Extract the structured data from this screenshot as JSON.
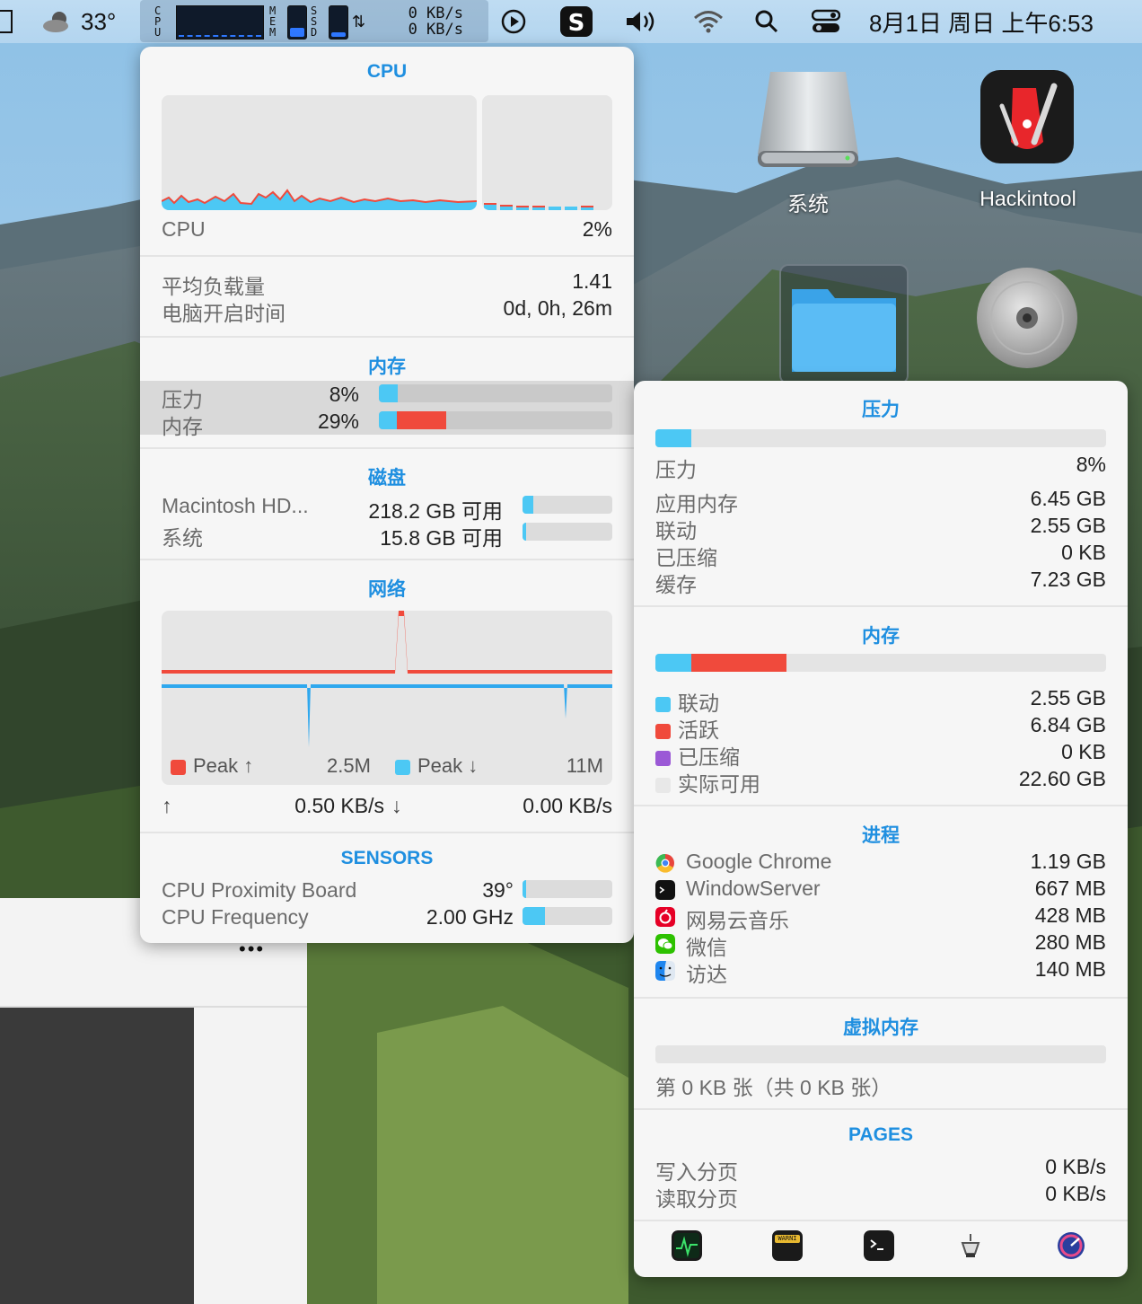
{
  "menubar": {
    "weather_temp": "33°",
    "cpu_letters": [
      "C",
      "P",
      "U"
    ],
    "mem_letters": [
      "M",
      "E",
      "M"
    ],
    "ssd_letters": [
      "S",
      "S",
      "D"
    ],
    "net_up": "0 KB/s",
    "net_down": "0 KB/s",
    "datetime": "8月1日 周日 上午6:53"
  },
  "desktop": {
    "icons": [
      {
        "label": "系统",
        "icon": "harddisk-icon"
      },
      {
        "label": "Hackintool",
        "icon": "hackintool-icon"
      },
      {
        "label": "",
        "icon": "folder-icon"
      },
      {
        "label": "",
        "icon": "disk-utility-icon"
      }
    ],
    "more_dots": "•••"
  },
  "left_panel": {
    "cpu": {
      "title": "CPU",
      "label": "CPU",
      "value": "2%",
      "load_label": "平均负载量",
      "load_value": "1.41",
      "uptime_label": "电脑开启时间",
      "uptime_value": "0d, 0h, 26m"
    },
    "memory": {
      "title": "内存",
      "pressure_label": "压力",
      "pressure_value": "8%",
      "pressure_fraction": 0.08,
      "memory_label": "内存",
      "memory_value": "29%",
      "memory_fraction": 0.29
    },
    "disk": {
      "title": "磁盘",
      "disks": [
        {
          "name": "Macintosh HD...",
          "free": "218.2 GB 可用",
          "used_fraction": 0.12
        },
        {
          "name": "系统",
          "free": "15.8 GB 可用",
          "used_fraction": 0.02
        }
      ]
    },
    "network": {
      "title": "网络",
      "peak_up_label": "Peak ↑",
      "peak_up_value": "2.5M",
      "peak_down_label": "Peak ↓",
      "peak_down_value": "11M",
      "up_arrow": "↑",
      "up_speed": "0.50 KB/s",
      "down_arrow": "↓",
      "down_speed": "0.00 KB/s"
    },
    "sensors": {
      "title": "SENSORS",
      "items": [
        {
          "name": "CPU Proximity Board",
          "value": "39°",
          "fraction": 0.02
        },
        {
          "name": "CPU Frequency",
          "value": "2.00 GHz",
          "fraction": 0.25
        }
      ]
    }
  },
  "right_panel": {
    "pressure": {
      "title": "压力",
      "fraction": 0.08,
      "rows": [
        {
          "label": "压力",
          "value": "8%"
        },
        {
          "label": "应用内存",
          "value": "6.45 GB"
        },
        {
          "label": "联动",
          "value": "2.55 GB"
        },
        {
          "label": "已压缩",
          "value": "0 KB"
        },
        {
          "label": "缓存",
          "value": "7.23 GB"
        }
      ]
    },
    "memory": {
      "title": "内存",
      "wired_fraction": 0.08,
      "active_fraction": 0.21,
      "legend": [
        {
          "label": "联动",
          "value": "2.55 GB",
          "color": "#4cc8f4"
        },
        {
          "label": "活跃",
          "value": "6.84 GB",
          "color": "#f04a3c"
        },
        {
          "label": "已压缩",
          "value": "0 KB",
          "color": "#9b59d6"
        },
        {
          "label": "实际可用",
          "value": "22.60 GB",
          "color": "#e8e8e8"
        }
      ]
    },
    "processes": {
      "title": "进程",
      "items": [
        {
          "name": "Google Chrome",
          "value": "1.19 GB",
          "icon": "chrome-icon"
        },
        {
          "name": "WindowServer",
          "value": "667 MB",
          "icon": "terminal-icon"
        },
        {
          "name": "网易云音乐",
          "value": "428 MB",
          "icon": "netease-music-icon"
        },
        {
          "name": "微信",
          "value": "280 MB",
          "icon": "wechat-icon"
        },
        {
          "name": "访达",
          "value": "140 MB",
          "icon": "finder-icon"
        }
      ]
    },
    "swap": {
      "title": "虚拟内存",
      "text": "第 0 KB 张（共 0 KB 张）"
    },
    "pages": {
      "title": "PAGES",
      "rows": [
        {
          "label": "写入分页",
          "value": "0 KB/s"
        },
        {
          "label": "读取分页",
          "value": "0 KB/s"
        }
      ]
    },
    "dock": {
      "icons": [
        "activity-monitor-icon",
        "console-icon",
        "terminal-icon",
        "system-info-icon",
        "disk-diag-icon"
      ],
      "console_text": "WARNI"
    }
  }
}
